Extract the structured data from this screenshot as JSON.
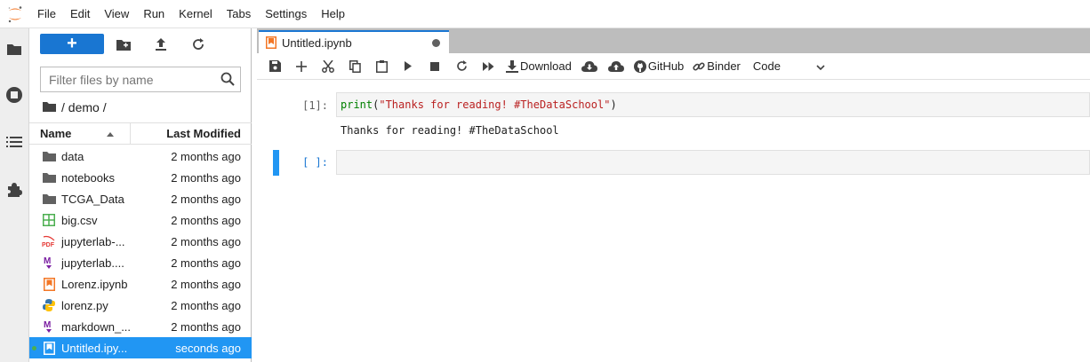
{
  "menubar": {
    "items": [
      "File",
      "Edit",
      "View",
      "Run",
      "Kernel",
      "Tabs",
      "Settings",
      "Help"
    ]
  },
  "activity_bar": {
    "icons": [
      "folder-icon",
      "running-icon",
      "toc-icon",
      "extension-icon"
    ]
  },
  "file_browser": {
    "new_button_label": "+",
    "search_placeholder": "Filter files by name",
    "breadcrumb": "/ demo /",
    "columns": {
      "name": "Name",
      "modified": "Last Modified"
    },
    "files": [
      {
        "name": "data",
        "modified": "2 months ago",
        "icon": "folder-icon"
      },
      {
        "name": "notebooks",
        "modified": "2 months ago",
        "icon": "folder-icon"
      },
      {
        "name": "TCGA_Data",
        "modified": "2 months ago",
        "icon": "folder-icon"
      },
      {
        "name": "big.csv",
        "modified": "2 months ago",
        "icon": "spreadsheet-icon"
      },
      {
        "name": "jupyterlab-...",
        "modified": "2 months ago",
        "icon": "pdf-icon"
      },
      {
        "name": "jupyterlab....",
        "modified": "2 months ago",
        "icon": "markdown-icon"
      },
      {
        "name": "Lorenz.ipynb",
        "modified": "2 months ago",
        "icon": "notebook-icon"
      },
      {
        "name": "lorenz.py",
        "modified": "2 months ago",
        "icon": "python-icon"
      },
      {
        "name": "markdown_...",
        "modified": "2 months ago",
        "icon": "markdown-icon"
      },
      {
        "name": "Untitled.ipy...",
        "modified": "seconds ago",
        "icon": "notebook-icon",
        "selected": true
      }
    ]
  },
  "notebook": {
    "tab_title": "Untitled.ipynb",
    "toolbar": {
      "download_label": "Download",
      "github_label": "GitHub",
      "binder_label": "Binder",
      "cell_type": "Code"
    },
    "cells": [
      {
        "prompt": "[1]:",
        "code_keyword": "print",
        "code_open": "(",
        "code_string": "\"Thanks for reading! #TheDataSchool\"",
        "code_close": ")",
        "output": "Thanks for reading! #TheDataSchool"
      },
      {
        "prompt": "[ ]:",
        "code": ""
      }
    ]
  },
  "colors": {
    "accent": "#1976d2",
    "selection": "#2196f3",
    "jupyter_orange": "#f37726"
  }
}
